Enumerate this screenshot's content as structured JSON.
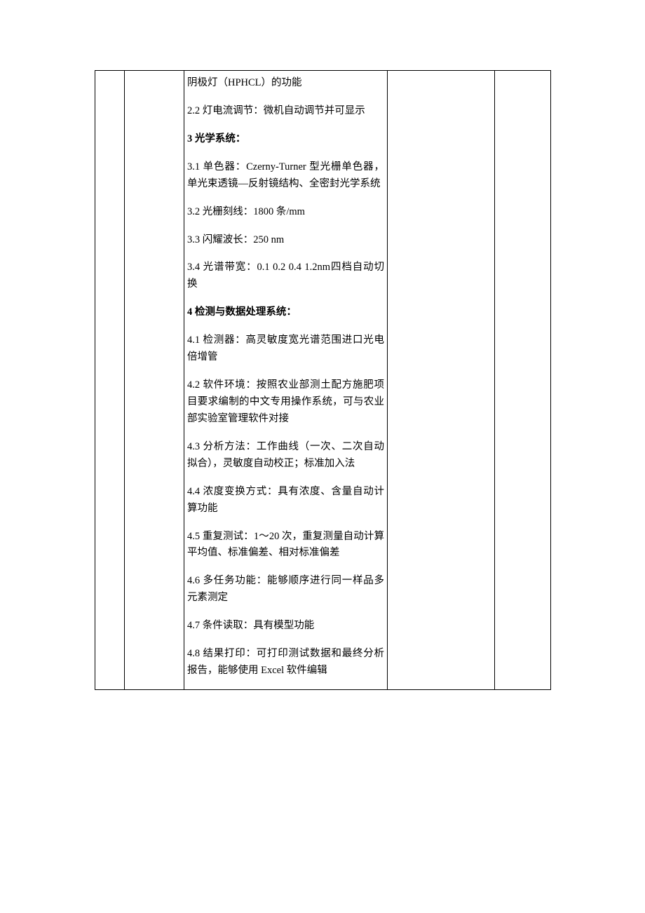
{
  "cells": {
    "c1": "",
    "c2": "",
    "c4": "",
    "c5": ""
  },
  "content": [
    {
      "bold": false,
      "text": "阴极灯（HPHCL）的功能"
    },
    {
      "bold": false,
      "text": "2.2 灯电流调节：微机自动调节并可显示"
    },
    {
      "bold": true,
      "text": "3 光学系统："
    },
    {
      "bold": false,
      "text": "3.1 单色器：Czerny-Turner 型光栅单色器，单光束透镜—反射镜结构、全密封光学系统"
    },
    {
      "bold": false,
      "text": "3.2 光栅刻线：1800 条/mm"
    },
    {
      "bold": false,
      "text": "3.3 闪耀波长：250 nm"
    },
    {
      "bold": false,
      "text": "3.4 光谱带宽：0.1 0.2 0.4 1.2nm四档自动切换"
    },
    {
      "bold": true,
      "text": "4 检测与数据处理系统："
    },
    {
      "bold": false,
      "text": "4.1 检测器：高灵敏度宽光谱范围进口光电倍增管"
    },
    {
      "bold": false,
      "text": "4.2 软件环境：按照农业部测土配方施肥项目要求编制的中文专用操作系统，可与农业部实验室管理软件对接"
    },
    {
      "bold": false,
      "text": "4.3 分析方法：工作曲线（一次、二次自动拟合），灵敏度自动校正；标准加入法"
    },
    {
      "bold": false,
      "text": "4.4 浓度变换方式：具有浓度、含量自动计算功能"
    },
    {
      "bold": false,
      "text": "4.5 重复测试：1～20 次，重复测量自动计算平均值、标准偏差、相对标准偏差"
    },
    {
      "bold": false,
      "text": "4.6 多任务功能：能够顺序进行同一样品多元素测定"
    },
    {
      "bold": false,
      "text": "4.7 条件读取：具有模型功能"
    },
    {
      "bold": false,
      "text": "4.8 结果打印：可打印测试数据和最终分析报告，能够使用 Excel 软件编辑"
    }
  ]
}
